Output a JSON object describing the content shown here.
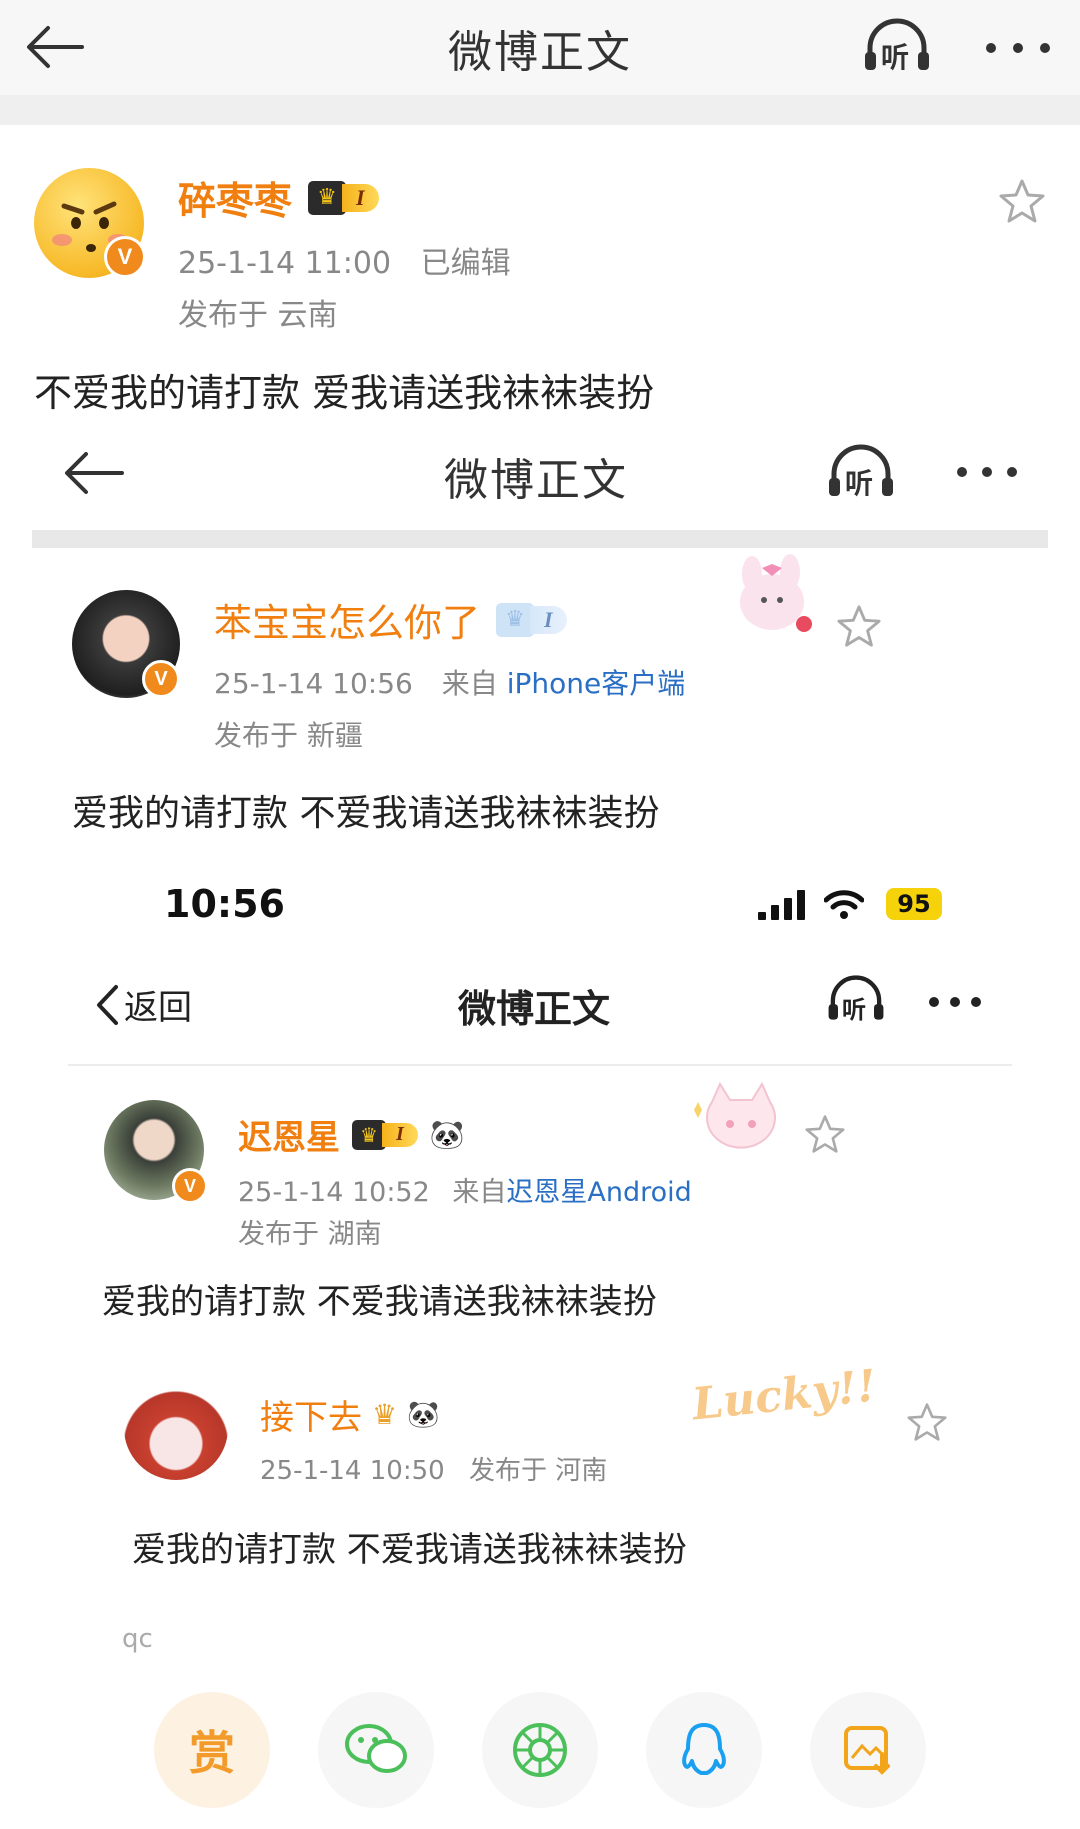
{
  "outer_nav": {
    "title": "微博正文",
    "listen_label": "听"
  },
  "outer_post": {
    "name": "碎枣枣",
    "level": "I",
    "time": "25-1-14 11:00",
    "edited": "已编辑",
    "location": "发布于 云南",
    "text": "不爱我的请打款 爱我请送我袜袜装扮"
  },
  "shot1": {
    "nav_title": "微博正文",
    "listen_label": "听",
    "name": "苯宝宝怎么你了",
    "level": "I",
    "time": "25-1-14 10:56",
    "source_prefix": "来自",
    "source": "iPhone客户端",
    "location": "发布于 新疆",
    "text": "爱我的请打款 不爱我请送我袜袜装扮"
  },
  "shot2": {
    "status_time": "10:56",
    "battery": "95",
    "back_label": "返回",
    "nav_title": "微博正文",
    "listen_label": "听",
    "name": "迟恩星",
    "level": "I",
    "time": "25-1-14 10:52",
    "source_prefix": "来自",
    "source": "迟恩星Android",
    "location": "发布于 湖南",
    "text": "爱我的请打款 不爱我请送我袜袜装扮"
  },
  "shot3": {
    "name": "接下去",
    "time": "25-1-14 10:50",
    "location": "发布于 河南",
    "text": "爱我的请打款 不爱我请送我袜袜装扮",
    "sticker_text": "Lucky!!"
  },
  "bottom": {
    "watermark": "qc",
    "reward_label": "赏",
    "icons": [
      "wechat-icon",
      "moments-icon",
      "qq-icon",
      "save-image-icon"
    ]
  },
  "colors": {
    "name_orange": "#f07f10",
    "meta_gray": "#888888",
    "link_blue": "#2a6fc4",
    "v_badge": "#f08a1c"
  }
}
